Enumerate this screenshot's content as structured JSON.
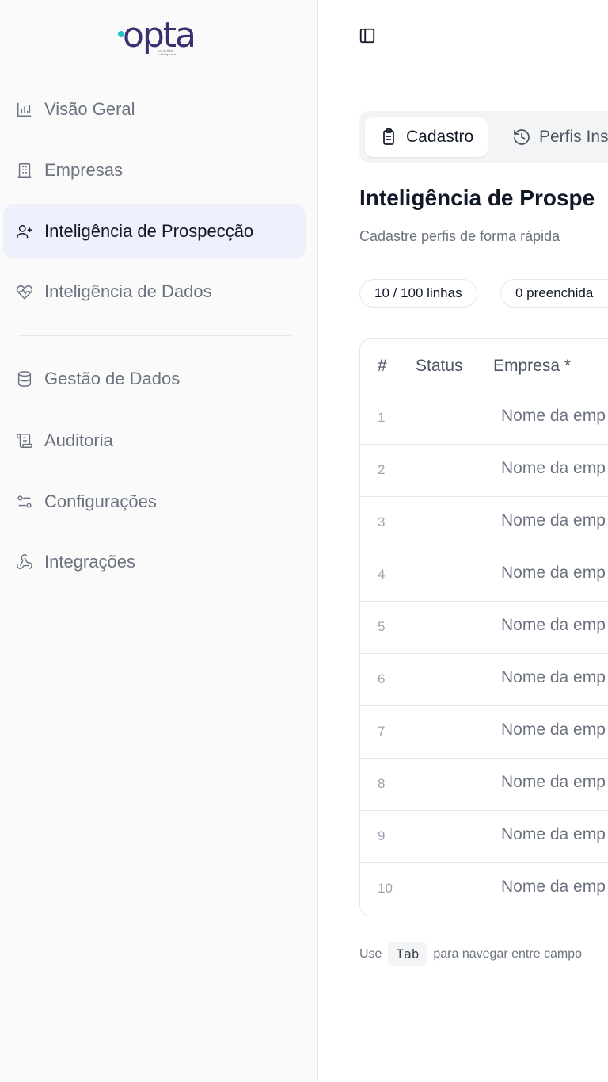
{
  "brand": {
    "logo_text": "opta",
    "logo_tagline": "soluções inteligentes",
    "accent_dot_color": "#22c1c3",
    "logo_color": "#3b2f6e"
  },
  "sidebar": {
    "items": [
      {
        "label": "Visão Geral",
        "icon": "bar-chart-icon",
        "active": false
      },
      {
        "label": "Empresas",
        "icon": "building-icon",
        "active": false
      },
      {
        "label": "Inteligência de Prospecção",
        "icon": "user-plus-icon",
        "active": true
      },
      {
        "label": "Inteligência de Dados",
        "icon": "heart-pulse-icon",
        "active": false
      },
      {
        "label": "Gestão de Dados",
        "icon": "database-icon",
        "active": false
      },
      {
        "label": "Auditoria",
        "icon": "scroll-icon",
        "active": false
      },
      {
        "label": "Configurações",
        "icon": "sliders-icon",
        "active": false
      },
      {
        "label": "Integrações",
        "icon": "webhook-icon",
        "active": false
      }
    ]
  },
  "header": {
    "toggle_icon": "sidebar-toggle-icon"
  },
  "tabs": [
    {
      "label": "Cadastro",
      "icon": "clipboard-icon",
      "active": true
    },
    {
      "label": "Perfis Ins",
      "icon": "history-icon",
      "active": false
    }
  ],
  "page": {
    "title": "Inteligência de Prospe",
    "subtitle": "Cadastre perfis de forma rápida"
  },
  "badges": {
    "rows": "10 / 100 linhas",
    "filled": "0 preenchida"
  },
  "table": {
    "columns": [
      "#",
      "Status",
      "Empresa *"
    ],
    "rows": [
      {
        "num": "1",
        "empresa": "Nome da emp"
      },
      {
        "num": "2",
        "empresa": "Nome da emp"
      },
      {
        "num": "3",
        "empresa": "Nome da emp"
      },
      {
        "num": "4",
        "empresa": "Nome da emp"
      },
      {
        "num": "5",
        "empresa": "Nome da emp"
      },
      {
        "num": "6",
        "empresa": "Nome da emp"
      },
      {
        "num": "7",
        "empresa": "Nome da emp"
      },
      {
        "num": "8",
        "empresa": "Nome da emp"
      },
      {
        "num": "9",
        "empresa": "Nome da emp"
      },
      {
        "num": "10",
        "empresa": "Nome da emp"
      }
    ]
  },
  "hint": {
    "prefix": "Use",
    "key": "Tab",
    "suffix": "para navegar entre campo"
  }
}
